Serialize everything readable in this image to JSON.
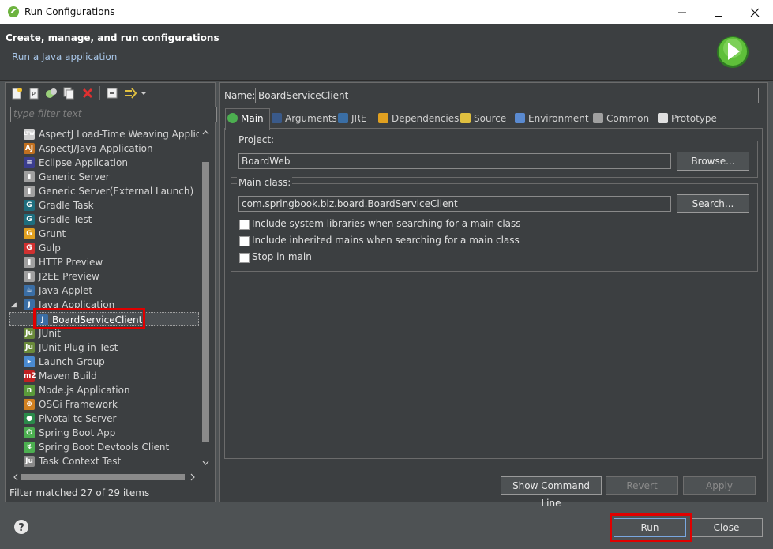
{
  "window": {
    "title": "Run Configurations"
  },
  "header": {
    "title": "Create, manage, and run configurations",
    "subtitle": "Run a Java application"
  },
  "left": {
    "filter_placeholder": "type filter text",
    "status": "Filter matched 27 of 29 items",
    "tree": [
      {
        "label": "AspectJ Load-Time Weaving Applicat",
        "icon": "ltw-icon",
        "color": "#d0d0d0",
        "glyph": "LTW"
      },
      {
        "label": "AspectJ/Java Application",
        "icon": "aspectj-icon",
        "color": "#c07020",
        "glyph": "AJ"
      },
      {
        "label": "Eclipse Application",
        "icon": "eclipse-icon",
        "color": "#3b3e8f",
        "glyph": "≡"
      },
      {
        "label": "Generic Server",
        "icon": "server-icon",
        "color": "#a0a0a0",
        "glyph": "▮"
      },
      {
        "label": "Generic Server(External Launch)",
        "icon": "server-icon",
        "color": "#a0a0a0",
        "glyph": "▮"
      },
      {
        "label": "Gradle Task",
        "icon": "gradle-icon",
        "color": "#1e6e7e",
        "glyph": "G"
      },
      {
        "label": "Gradle Test",
        "icon": "gradle-icon",
        "color": "#1e6e7e",
        "glyph": "G"
      },
      {
        "label": "Grunt",
        "icon": "grunt-icon",
        "color": "#e0a020",
        "glyph": "G"
      },
      {
        "label": "Gulp",
        "icon": "gulp-icon",
        "color": "#d03030",
        "glyph": "G"
      },
      {
        "label": "HTTP Preview",
        "icon": "server-icon",
        "color": "#a0a0a0",
        "glyph": "▮"
      },
      {
        "label": "J2EE Preview",
        "icon": "server-icon",
        "color": "#a0a0a0",
        "glyph": "▮"
      },
      {
        "label": "Java Applet",
        "icon": "applet-icon",
        "color": "#3a6ea5",
        "glyph": "☕"
      },
      {
        "label": "Java Application",
        "icon": "java-app-icon",
        "color": "#3a6ea5",
        "glyph": "J",
        "expanded": true
      },
      {
        "label": "BoardServiceClient",
        "icon": "java-app-icon",
        "color": "#3a6ea5",
        "glyph": "J",
        "child": true,
        "selected": true
      },
      {
        "label": "JUnit",
        "icon": "junit-icon",
        "color": "#6a8a3a",
        "glyph": "Ju"
      },
      {
        "label": "JUnit Plug-in Test",
        "icon": "junit-icon",
        "color": "#6a8a3a",
        "glyph": "Ju"
      },
      {
        "label": "Launch Group",
        "icon": "launch-group-icon",
        "color": "#4a8ad0",
        "glyph": "▸"
      },
      {
        "label": "Maven Build",
        "icon": "maven-icon",
        "color": "#c02020",
        "glyph": "m2"
      },
      {
        "label": "Node.js Application",
        "icon": "nodejs-icon",
        "color": "#5a9a3a",
        "glyph": "n"
      },
      {
        "label": "OSGi Framework",
        "icon": "osgi-icon",
        "color": "#d08020",
        "glyph": "⊕"
      },
      {
        "label": "Pivotal tc Server",
        "icon": "pivotal-icon",
        "color": "#2a8a4a",
        "glyph": "●"
      },
      {
        "label": "Spring Boot App",
        "icon": "spring-boot-icon",
        "color": "#4caf50",
        "glyph": "⏻"
      },
      {
        "label": "Spring Boot Devtools Client",
        "icon": "spring-devtools-icon",
        "color": "#4caf50",
        "glyph": "↯"
      },
      {
        "label": "Task Context Test",
        "icon": "task-test-icon",
        "color": "#8a8a8a",
        "glyph": "Ju"
      }
    ]
  },
  "right": {
    "name_label": "Name:",
    "name_value": "BoardServiceClient",
    "tabs": [
      {
        "label": "Main",
        "icon": "main-tab-icon"
      },
      {
        "label": "Arguments",
        "icon": "arguments-tab-icon"
      },
      {
        "label": "JRE",
        "icon": "jre-tab-icon"
      },
      {
        "label": "Dependencies",
        "icon": "dependencies-tab-icon"
      },
      {
        "label": "Source",
        "icon": "source-tab-icon"
      },
      {
        "label": "Environment",
        "icon": "environment-tab-icon"
      },
      {
        "label": "Common",
        "icon": "common-tab-icon"
      },
      {
        "label": "Prototype",
        "icon": "prototype-tab-icon"
      }
    ],
    "project_label": "Project:",
    "project_value": "BoardWeb",
    "browse_label": "Browse...",
    "main_class_label": "Main class:",
    "main_class_value": "com.springbook.biz.board.BoardServiceClient",
    "search_label": "Search...",
    "checkboxes": [
      {
        "label": "Include system libraries when searching for a main class",
        "checked": false
      },
      {
        "label": "Include inherited mains when searching for a main class",
        "checked": false
      },
      {
        "label": "Stop in main",
        "checked": false
      }
    ],
    "show_command_line": "Show Command Line",
    "revert": "Revert",
    "apply": "Apply"
  },
  "footer": {
    "run": "Run",
    "close": "Close"
  },
  "colors": {
    "accent_red": "#e00000",
    "panel": "#3c3f41",
    "background": "#4e5254"
  }
}
